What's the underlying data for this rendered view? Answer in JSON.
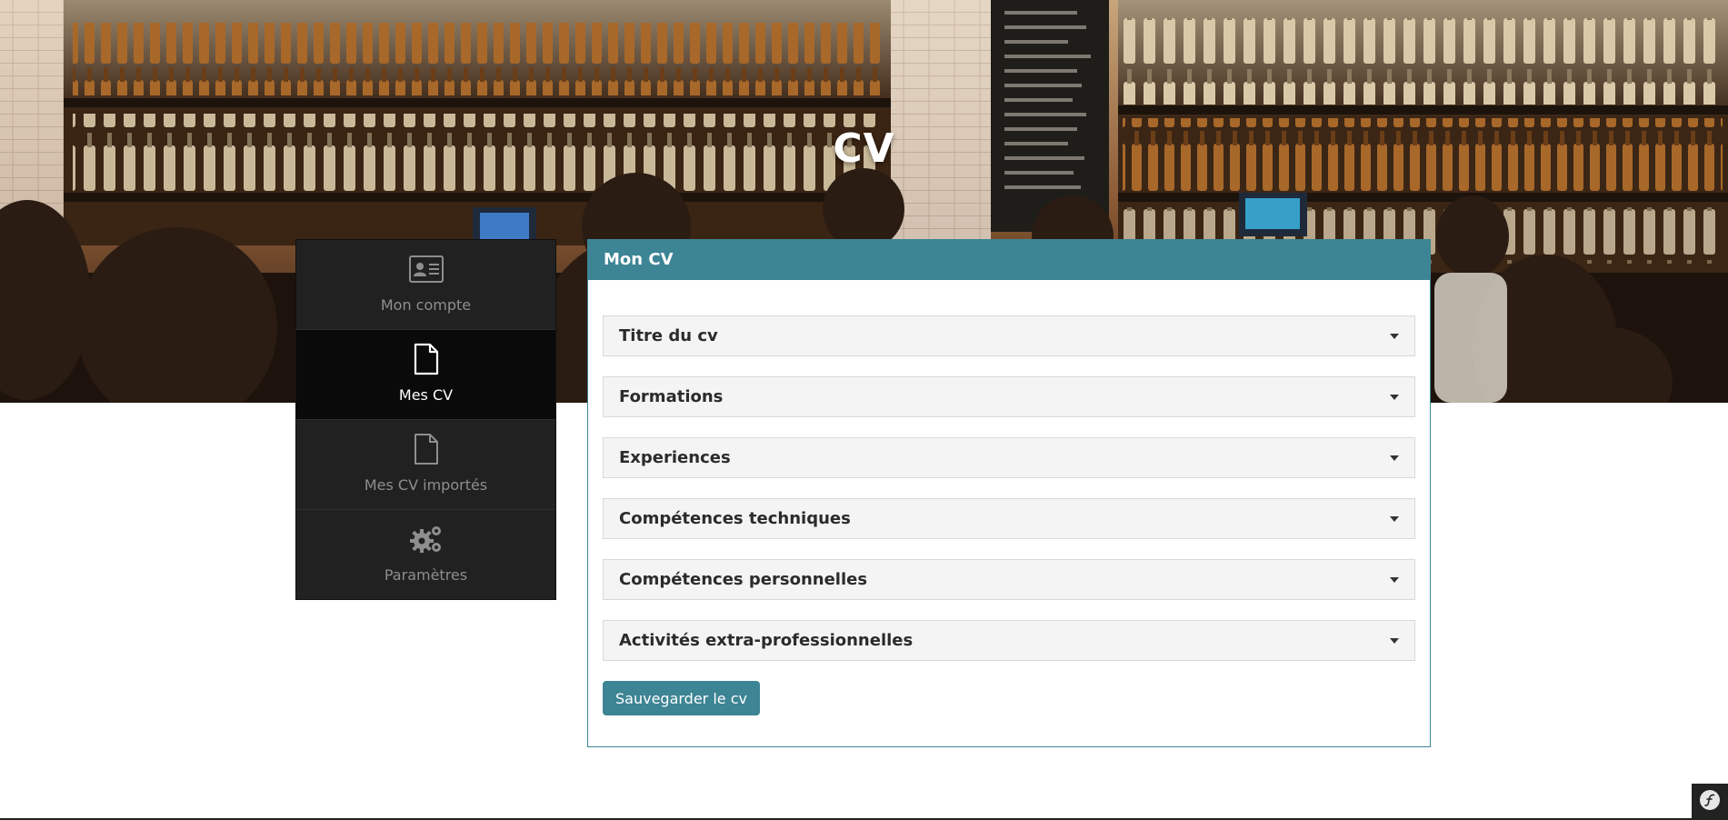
{
  "hero": {
    "title": "CV"
  },
  "sidebar": {
    "items": [
      {
        "label": "Mon compte",
        "icon": "id-card-icon",
        "active": false
      },
      {
        "label": "Mes CV",
        "icon": "file-icon",
        "active": true
      },
      {
        "label": "Mes CV importés",
        "icon": "file-outline-icon",
        "active": false
      },
      {
        "label": "Paramètres",
        "icon": "gears-icon",
        "active": false
      }
    ]
  },
  "panel": {
    "title": "Mon CV",
    "sections": [
      "Titre du cv",
      "Formations",
      "Experiences",
      "Compétences techniques",
      "Compétences personnelles",
      "Activités extra-professionnelles"
    ],
    "save_label": "Sauvegarder le cv"
  },
  "colors": {
    "accent": "#3d8494",
    "sidebar_bg": "#212121",
    "sidebar_active_bg": "#0a0a0a"
  },
  "debug_badge": {
    "icon": "symfony-icon"
  }
}
